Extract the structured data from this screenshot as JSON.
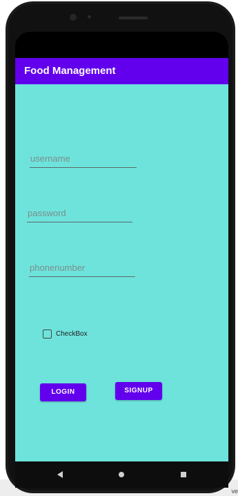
{
  "app_bar": {
    "title": "Food Management"
  },
  "form": {
    "username": {
      "placeholder": "username",
      "value": ""
    },
    "password": {
      "placeholder": "password",
      "value": ""
    },
    "phone": {
      "placeholder": "phonenumber",
      "value": ""
    },
    "checkbox": {
      "label": "CheckBox",
      "checked": false
    },
    "login_label": "LOGIN",
    "signup_label": "SIGNUP"
  },
  "nav": {
    "back_icon": "back-triangle-icon",
    "home_icon": "home-circle-icon",
    "recents_icon": "recents-square-icon"
  },
  "corner_text": "ve",
  "colors": {
    "primary": "#6200ee",
    "background": "#6ee3db",
    "status_bar": "#000000"
  }
}
